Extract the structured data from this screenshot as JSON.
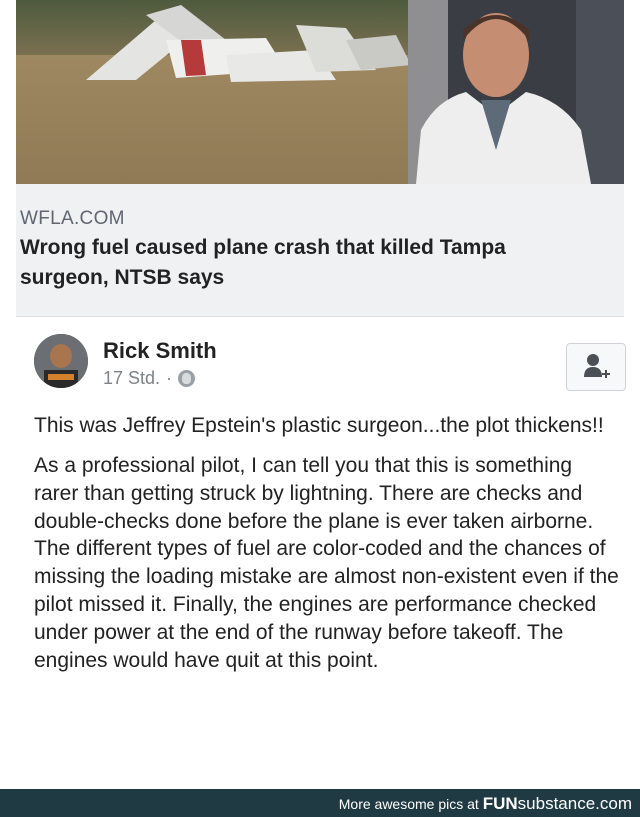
{
  "link_preview": {
    "domain": "WFLA.COM",
    "headline": "Wrong fuel caused plane crash that killed Tampa surgeon, NTSB says"
  },
  "post": {
    "author": "Rick Smith",
    "time": "17 Std.",
    "separator": "·",
    "paragraphs": [
      "This was Jeffrey Epstein's plastic surgeon...the plot thickens!!",
      "As a professional pilot, I can tell you that this is something rarer than getting struck by lightning. There are checks and double-checks done before the plane is ever taken airborne. The different types of fuel are color-coded and the chances of missing the loading mistake are almost non-existent even if the pilot missed it. Finally, the engines are performance checked under power at the end of the runway before takeoff. The engines would have quit at this point."
    ]
  },
  "watermark": {
    "prefix": "More awesome pics at",
    "brand_bold": "FUN",
    "brand_rest": "substance.com"
  },
  "colors": {
    "footer_bg": "#1f3a42",
    "card_bg": "#f0f1f3",
    "text": "#222222",
    "muted": "#7d8288"
  }
}
